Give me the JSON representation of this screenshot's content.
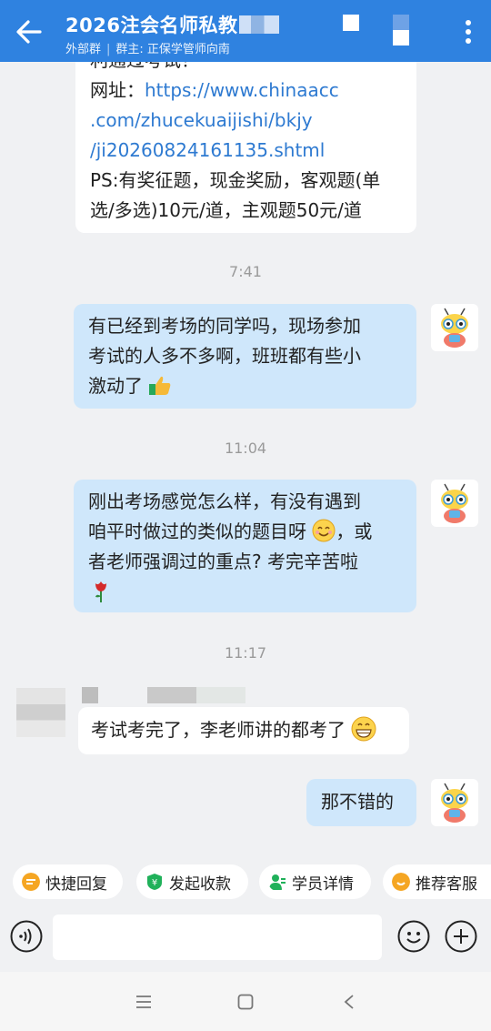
{
  "header": {
    "title": "2026注会名师私教",
    "ext_label": "外部群",
    "owner_label": "群主: 正保学管师向南"
  },
  "messages": {
    "m1": {
      "line1": "利通过考试！",
      "url_label": "网址：",
      "url1": "https://www.chinaacc",
      "url2": ".com/zhucekuaijishi/bkjy",
      "url3": "/ji20260824161135.shtml",
      "line5": "PS:有奖征题，现金奖励，客观题(单",
      "line6": "选/多选)10元/道，主观题50元/道"
    },
    "t1": "7:41",
    "m2": {
      "line1": "有已经到考场的同学吗，现场参加",
      "line2": "考试的人多不多啊，班班都有些小",
      "line3": "激动了"
    },
    "t2": "11:04",
    "m3": {
      "line1": "刚出考场感觉怎么样，有没有遇到",
      "line2": "咱平时做过的类似的题目呀",
      "line2b": "，或",
      "line3": "者老师强调过的重点? 考完辛苦啦"
    },
    "t3": "11:17",
    "m4": {
      "text": "考试考完了，李老师讲的都考了"
    },
    "m5": {
      "text": "那不错的"
    }
  },
  "quick_actions": {
    "reply": "快捷回复",
    "payment": "发起收款",
    "student": "学员详情",
    "service": "推荐客服"
  },
  "colors": {
    "header": "#2f82e0",
    "bubble_blue": "#cfe7fb",
    "link": "#2e7ad1"
  },
  "icons": [
    "back-arrow-icon",
    "square-icon",
    "more-icon",
    "voice-icon",
    "emoji-icon",
    "plus-icon",
    "menu-icon",
    "home-icon",
    "back-nav-icon"
  ]
}
